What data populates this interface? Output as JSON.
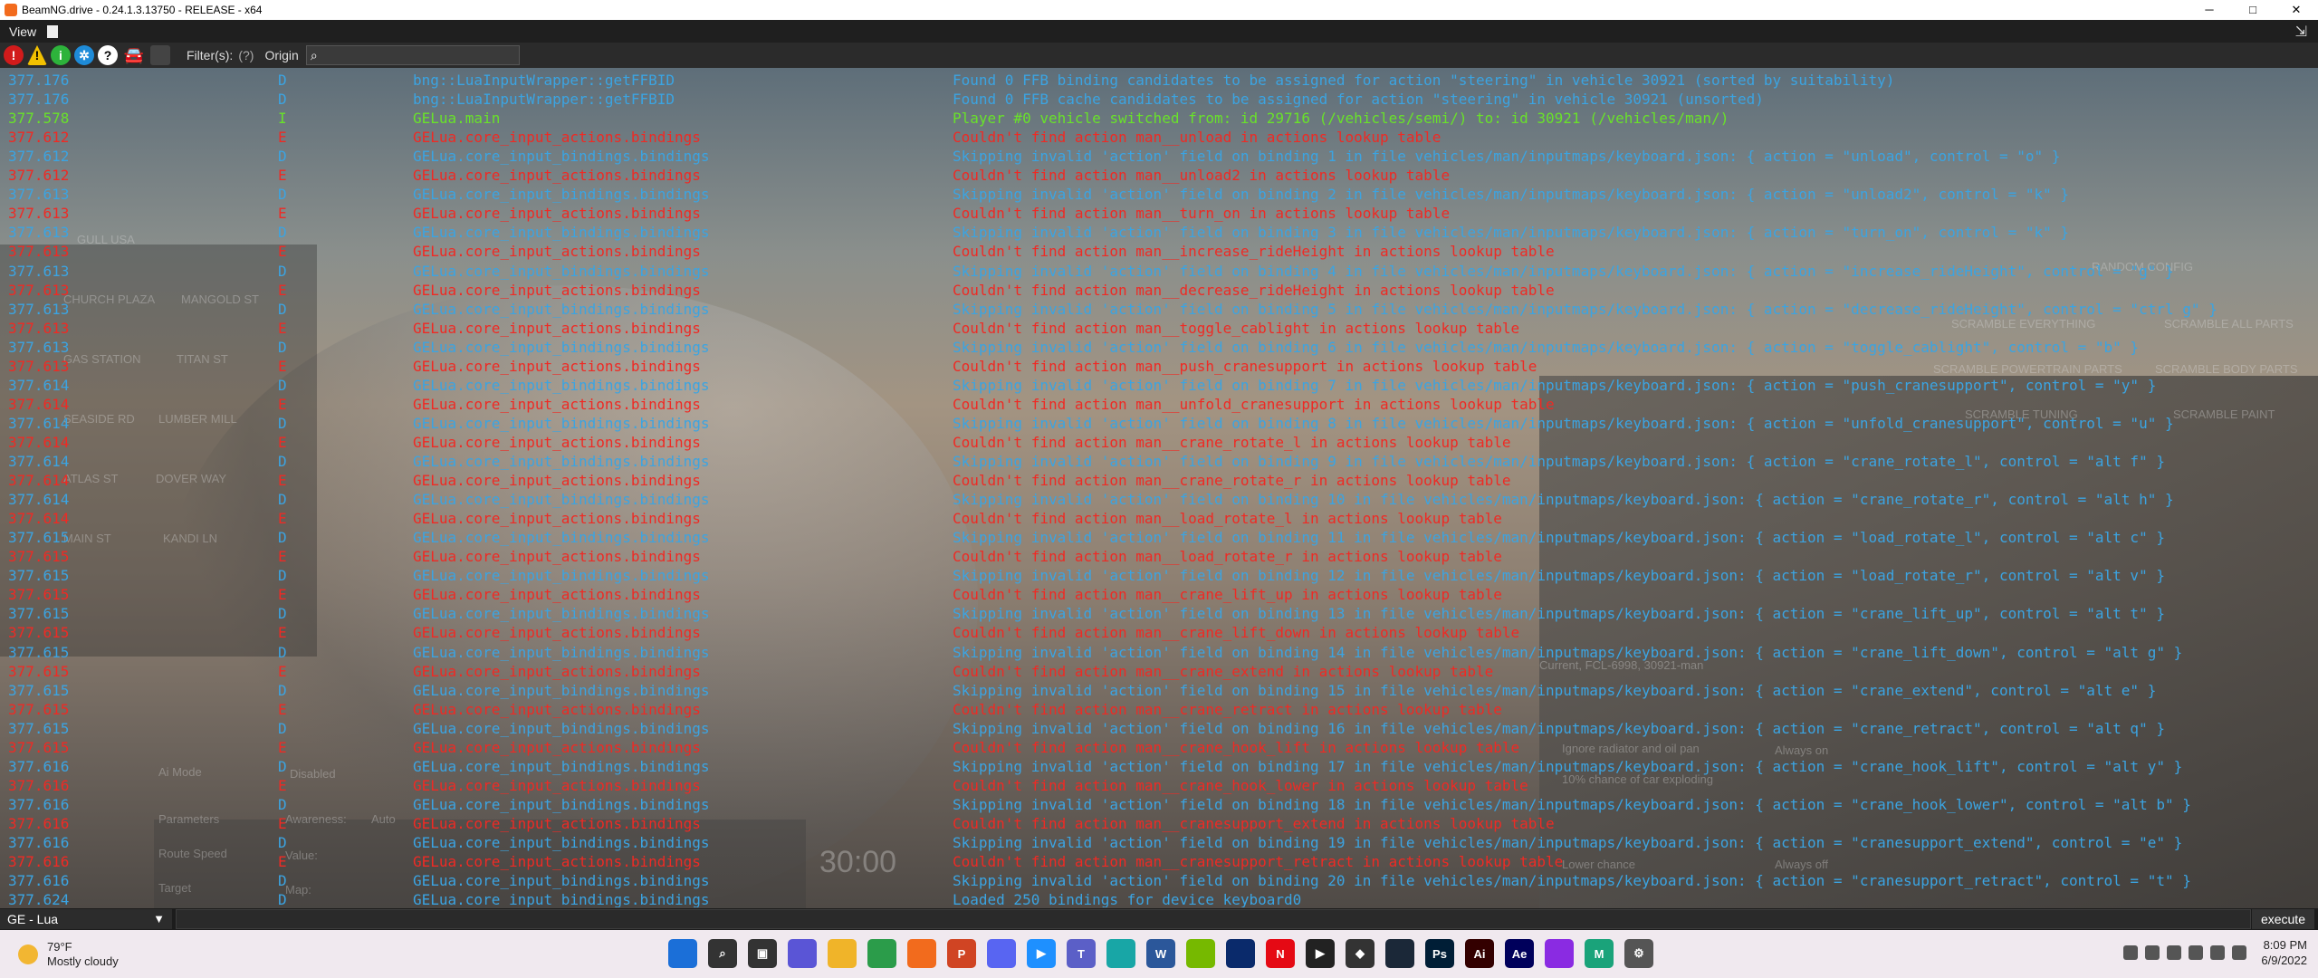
{
  "window": {
    "title": "BeamNG.drive - 0.24.1.3.13750 - RELEASE - x64",
    "min": "─",
    "max": "□",
    "close": "✕"
  },
  "menu": {
    "view": "View",
    "expand": "⇲"
  },
  "toolbar": {
    "filters_label": "Filter(s):",
    "filters_help": "(?)",
    "origin_label": "Origin",
    "search_value": ""
  },
  "colors": {
    "debug": "#3ba4e2",
    "info": "#69e22a",
    "error": "#ef2a24"
  },
  "log": [
    {
      "t": "377.176",
      "l": "D",
      "o": "bng::LuaInputWrapper::getFFBID",
      "m": "Found 0 FFB binding candidates to be assigned for action \"steering\" in vehicle 30921 (sorted by suitability)"
    },
    {
      "t": "377.176",
      "l": "D",
      "o": "bng::LuaInputWrapper::getFFBID",
      "m": "Found 0 FFB cache candidates to be assigned for action \"steering\" in vehicle 30921 (unsorted)"
    },
    {
      "t": "377.578",
      "l": "I",
      "o": "GELua.main",
      "m": "Player #0 vehicle switched from: id 29716 (/vehicles/semi/) to: id 30921 (/vehicles/man/)"
    },
    {
      "t": "377.612",
      "l": "E",
      "o": "GELua.core_input_actions.bindings",
      "m": "Couldn't find action man__unload in actions lookup table"
    },
    {
      "t": "377.612",
      "l": "D",
      "o": "GELua.core_input_bindings.bindings",
      "m": "Skipping invalid 'action' field on binding 1 in file vehicles/man/inputmaps/keyboard.json: { action = \"unload\", control = \"o\" }"
    },
    {
      "t": "377.612",
      "l": "E",
      "o": "GELua.core_input_actions.bindings",
      "m": "Couldn't find action man__unload2 in actions lookup table"
    },
    {
      "t": "377.613",
      "l": "D",
      "o": "GELua.core_input_bindings.bindings",
      "m": "Skipping invalid 'action' field on binding 2 in file vehicles/man/inputmaps/keyboard.json: { action = \"unload2\", control = \"k\" }"
    },
    {
      "t": "377.613",
      "l": "E",
      "o": "GELua.core_input_actions.bindings",
      "m": "Couldn't find action man__turn_on in actions lookup table"
    },
    {
      "t": "377.613",
      "l": "D",
      "o": "GELua.core_input_bindings.bindings",
      "m": "Skipping invalid 'action' field on binding 3 in file vehicles/man/inputmaps/keyboard.json: { action = \"turn_on\", control = \"k\" }"
    },
    {
      "t": "377.613",
      "l": "E",
      "o": "GELua.core_input_actions.bindings",
      "m": "Couldn't find action man__increase_rideHeight in actions lookup table"
    },
    {
      "t": "377.613",
      "l": "D",
      "o": "GELua.core_input_bindings.bindings",
      "m": "Skipping invalid 'action' field on binding 4 in file vehicles/man/inputmaps/keyboard.json: { action = \"increase_rideHeight\", control = \"g\" }"
    },
    {
      "t": "377.613",
      "l": "E",
      "o": "GELua.core_input_actions.bindings",
      "m": "Couldn't find action man__decrease_rideHeight in actions lookup table"
    },
    {
      "t": "377.613",
      "l": "D",
      "o": "GELua.core_input_bindings.bindings",
      "m": "Skipping invalid 'action' field on binding 5 in file vehicles/man/inputmaps/keyboard.json: { action = \"decrease_rideHeight\", control = \"ctrl g\" }"
    },
    {
      "t": "377.613",
      "l": "E",
      "o": "GELua.core_input_actions.bindings",
      "m": "Couldn't find action man__toggle_cablight in actions lookup table"
    },
    {
      "t": "377.613",
      "l": "D",
      "o": "GELua.core_input_bindings.bindings",
      "m": "Skipping invalid 'action' field on binding 6 in file vehicles/man/inputmaps/keyboard.json: { action = \"toggle_cablight\", control = \"b\" }"
    },
    {
      "t": "377.613",
      "l": "E",
      "o": "GELua.core_input_actions.bindings",
      "m": "Couldn't find action man__push_cranesupport in actions lookup table"
    },
    {
      "t": "377.614",
      "l": "D",
      "o": "GELua.core_input_bindings.bindings",
      "m": "Skipping invalid 'action' field on binding 7 in file vehicles/man/inputmaps/keyboard.json: { action = \"push_cranesupport\", control = \"y\" }"
    },
    {
      "t": "377.614",
      "l": "E",
      "o": "GELua.core_input_actions.bindings",
      "m": "Couldn't find action man__unfold_cranesupport in actions lookup table"
    },
    {
      "t": "377.614",
      "l": "D",
      "o": "GELua.core_input_bindings.bindings",
      "m": "Skipping invalid 'action' field on binding 8 in file vehicles/man/inputmaps/keyboard.json: { action = \"unfold_cranesupport\", control = \"u\" }"
    },
    {
      "t": "377.614",
      "l": "E",
      "o": "GELua.core_input_actions.bindings",
      "m": "Couldn't find action man__crane_rotate_l in actions lookup table"
    },
    {
      "t": "377.614",
      "l": "D",
      "o": "GELua.core_input_bindings.bindings",
      "m": "Skipping invalid 'action' field on binding 9 in file vehicles/man/inputmaps/keyboard.json: { action = \"crane_rotate_l\", control = \"alt f\" }"
    },
    {
      "t": "377.614",
      "l": "E",
      "o": "GELua.core_input_actions.bindings",
      "m": "Couldn't find action man__crane_rotate_r in actions lookup table"
    },
    {
      "t": "377.614",
      "l": "D",
      "o": "GELua.core_input_bindings.bindings",
      "m": "Skipping invalid 'action' field on binding 10 in file vehicles/man/inputmaps/keyboard.json: { action = \"crane_rotate_r\", control = \"alt h\" }"
    },
    {
      "t": "377.614",
      "l": "E",
      "o": "GELua.core_input_actions.bindings",
      "m": "Couldn't find action man__load_rotate_l in actions lookup table"
    },
    {
      "t": "377.615",
      "l": "D",
      "o": "GELua.core_input_bindings.bindings",
      "m": "Skipping invalid 'action' field on binding 11 in file vehicles/man/inputmaps/keyboard.json: { action = \"load_rotate_l\", control = \"alt c\" }"
    },
    {
      "t": "377.615",
      "l": "E",
      "o": "GELua.core_input_actions.bindings",
      "m": "Couldn't find action man__load_rotate_r in actions lookup table"
    },
    {
      "t": "377.615",
      "l": "D",
      "o": "GELua.core_input_bindings.bindings",
      "m": "Skipping invalid 'action' field on binding 12 in file vehicles/man/inputmaps/keyboard.json: { action = \"load_rotate_r\", control = \"alt v\" }"
    },
    {
      "t": "377.615",
      "l": "E",
      "o": "GELua.core_input_actions.bindings",
      "m": "Couldn't find action man__crane_lift_up in actions lookup table"
    },
    {
      "t": "377.615",
      "l": "D",
      "o": "GELua.core_input_bindings.bindings",
      "m": "Skipping invalid 'action' field on binding 13 in file vehicles/man/inputmaps/keyboard.json: { action = \"crane_lift_up\", control = \"alt t\" }"
    },
    {
      "t": "377.615",
      "l": "E",
      "o": "GELua.core_input_actions.bindings",
      "m": "Couldn't find action man__crane_lift_down in actions lookup table"
    },
    {
      "t": "377.615",
      "l": "D",
      "o": "GELua.core_input_bindings.bindings",
      "m": "Skipping invalid 'action' field on binding 14 in file vehicles/man/inputmaps/keyboard.json: { action = \"crane_lift_down\", control = \"alt g\" }"
    },
    {
      "t": "377.615",
      "l": "E",
      "o": "GELua.core_input_actions.bindings",
      "m": "Couldn't find action man__crane_extend in actions lookup table"
    },
    {
      "t": "377.615",
      "l": "D",
      "o": "GELua.core_input_bindings.bindings",
      "m": "Skipping invalid 'action' field on binding 15 in file vehicles/man/inputmaps/keyboard.json: { action = \"crane_extend\", control = \"alt e\" }"
    },
    {
      "t": "377.615",
      "l": "E",
      "o": "GELua.core_input_actions.bindings",
      "m": "Couldn't find action man__crane_retract in actions lookup table"
    },
    {
      "t": "377.615",
      "l": "D",
      "o": "GELua.core_input_bindings.bindings",
      "m": "Skipping invalid 'action' field on binding 16 in file vehicles/man/inputmaps/keyboard.json: { action = \"crane_retract\", control = \"alt q\" }"
    },
    {
      "t": "377.615",
      "l": "E",
      "o": "GELua.core_input_actions.bindings",
      "m": "Couldn't find action man__crane_hook_lift in actions lookup table"
    },
    {
      "t": "377.616",
      "l": "D",
      "o": "GELua.core_input_bindings.bindings",
      "m": "Skipping invalid 'action' field on binding 17 in file vehicles/man/inputmaps/keyboard.json: { action = \"crane_hook_lift\", control = \"alt y\" }"
    },
    {
      "t": "377.616",
      "l": "E",
      "o": "GELua.core_input_actions.bindings",
      "m": "Couldn't find action man__crane_hook_lower in actions lookup table"
    },
    {
      "t": "377.616",
      "l": "D",
      "o": "GELua.core_input_bindings.bindings",
      "m": "Skipping invalid 'action' field on binding 18 in file vehicles/man/inputmaps/keyboard.json: { action = \"crane_hook_lower\", control = \"alt b\" }"
    },
    {
      "t": "377.616",
      "l": "E",
      "o": "GELua.core_input_actions.bindings",
      "m": "Couldn't find action man__cranesupport_extend in actions lookup table"
    },
    {
      "t": "377.616",
      "l": "D",
      "o": "GELua.core_input_bindings.bindings",
      "m": "Skipping invalid 'action' field on binding 19 in file vehicles/man/inputmaps/keyboard.json: { action = \"cranesupport_extend\", control = \"e\" }"
    },
    {
      "t": "377.616",
      "l": "E",
      "o": "GELua.core_input_actions.bindings",
      "m": "Couldn't find action man__cranesupport_retract in actions lookup table"
    },
    {
      "t": "377.616",
      "l": "D",
      "o": "GELua.core_input_bindings.bindings",
      "m": "Skipping invalid 'action' field on binding 20 in file vehicles/man/inputmaps/keyboard.json: { action = \"cranesupport_retract\", control = \"t\" }"
    },
    {
      "t": "377.624",
      "l": "D",
      "o": "GELua.core_input_bindings.bindings",
      "m": "Loaded 250 bindings for device keyboard0"
    }
  ],
  "background_text": [
    "Ai Mode",
    "Disabled",
    "Parameters",
    "Awareness:",
    "Auto",
    "Route Speed",
    "Value:",
    "Target",
    "Map:",
    "GULL USA",
    "CHURCH PLAZA",
    "MANGOLD ST",
    "GAS STATION",
    "TITAN ST",
    "SEASIDE RD",
    "LUMBER MILL",
    "ATLAS ST",
    "DOVER WAY",
    "MAIN ST",
    "KANDI LN",
    "Current, FCL-6998, 30921-man",
    "Ignore radiator and oil pan",
    "Lower chance",
    "Always on",
    "Always off",
    "10% chance of car exploding",
    "RANDOM CONFIG",
    "SCRAMBLE EVERYTHING",
    "SCRAMBLE ALL PARTS",
    "SCRAMBLE POWERTRAIN PARTS",
    "SCRAMBLE BODY PARTS",
    "SCRAMBLE TUNING",
    "SCRAMBLE PAINT",
    "30:00"
  ],
  "bottom": {
    "mode": "GE - Lua",
    "execute": "execute",
    "command_value": ""
  },
  "taskbar": {
    "temp": "79°F",
    "weather": "Mostly cloudy",
    "time": "8:09 PM",
    "date": "6/9/2022",
    "apps": [
      {
        "name": "start-icon",
        "color": "#1b6fd8",
        "label": ""
      },
      {
        "name": "search-icon",
        "color": "#333",
        "label": "⌕"
      },
      {
        "name": "task-view-icon",
        "color": "#333",
        "label": "▣"
      },
      {
        "name": "chat-icon",
        "color": "#5a55d6",
        "label": ""
      },
      {
        "name": "file-explorer-icon",
        "color": "#f0b429",
        "label": ""
      },
      {
        "name": "chrome-icon",
        "color": "#2b9c4a",
        "label": ""
      },
      {
        "name": "beamng-icon",
        "color": "#f26b1d",
        "label": ""
      },
      {
        "name": "powerpoint-icon",
        "color": "#d04423",
        "label": "P"
      },
      {
        "name": "discord-icon",
        "color": "#5865f2",
        "label": ""
      },
      {
        "name": "media-icon",
        "color": "#1e90ff",
        "label": "▶"
      },
      {
        "name": "teams-icon",
        "color": "#5b5fc7",
        "label": "T"
      },
      {
        "name": "edge-icon",
        "color": "#18a6a6",
        "label": ""
      },
      {
        "name": "word-icon",
        "color": "#2b579a",
        "label": "W"
      },
      {
        "name": "nvidia-icon",
        "color": "#76b900",
        "label": ""
      },
      {
        "name": "disney-icon",
        "color": "#0a2a6b",
        "label": ""
      },
      {
        "name": "netflix-icon",
        "color": "#e50914",
        "label": "N"
      },
      {
        "name": "player-icon",
        "color": "#222",
        "label": "▶"
      },
      {
        "name": "unity-icon",
        "color": "#333",
        "label": "◆"
      },
      {
        "name": "steam-icon",
        "color": "#1b2838",
        "label": ""
      },
      {
        "name": "photoshop-icon",
        "color": "#001e36",
        "label": "Ps"
      },
      {
        "name": "illustrator-icon",
        "color": "#330000",
        "label": "Ai"
      },
      {
        "name": "after-effects-icon",
        "color": "#00005b",
        "label": "Ae"
      },
      {
        "name": "headset-icon",
        "color": "#8a2be2",
        "label": ""
      },
      {
        "name": "maps-icon",
        "color": "#1aa37a",
        "label": "M"
      },
      {
        "name": "settings-icon",
        "color": "#555",
        "label": "⚙"
      }
    ]
  }
}
